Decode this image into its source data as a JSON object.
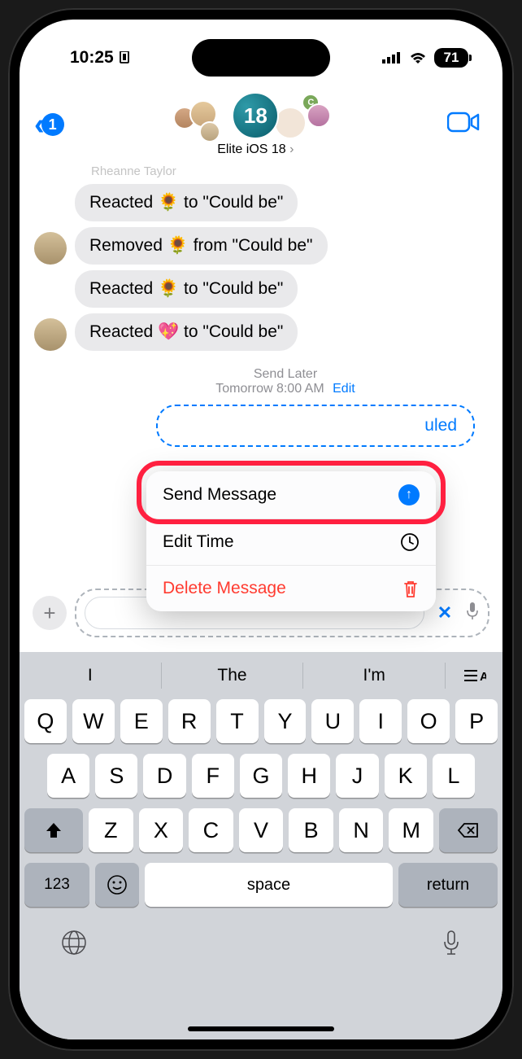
{
  "status": {
    "time": "10:25",
    "battery": "71"
  },
  "nav": {
    "back_badge": "1",
    "group_name": "Elite iOS 18",
    "avatar_center": "18",
    "avatar_small": "C"
  },
  "sender_name": "Rheanne Taylor",
  "messages": [
    "Reacted 🌻 to \"Could be\"",
    "Removed 🌻 from \"Could be\"",
    "Reacted 🌻 to \"Could be\"",
    "Reacted 💖 to \"Could be\""
  ],
  "scheduled": {
    "title": "Send Later",
    "time": "Tomorrow 8:00 AM",
    "edit": "Edit",
    "bubble_text": "uled"
  },
  "menu": {
    "send": "Send Message",
    "edit_time": "Edit Time",
    "delete": "Delete Message"
  },
  "predictive": {
    "a": "I",
    "b": "The",
    "c": "I'm"
  },
  "keys": {
    "row1": [
      "Q",
      "W",
      "E",
      "R",
      "T",
      "Y",
      "U",
      "I",
      "O",
      "P"
    ],
    "row2": [
      "A",
      "S",
      "D",
      "F",
      "G",
      "H",
      "J",
      "K",
      "L"
    ],
    "row3": [
      "Z",
      "X",
      "C",
      "V",
      "B",
      "N",
      "M"
    ],
    "num": "123",
    "space": "space",
    "return": "return"
  }
}
